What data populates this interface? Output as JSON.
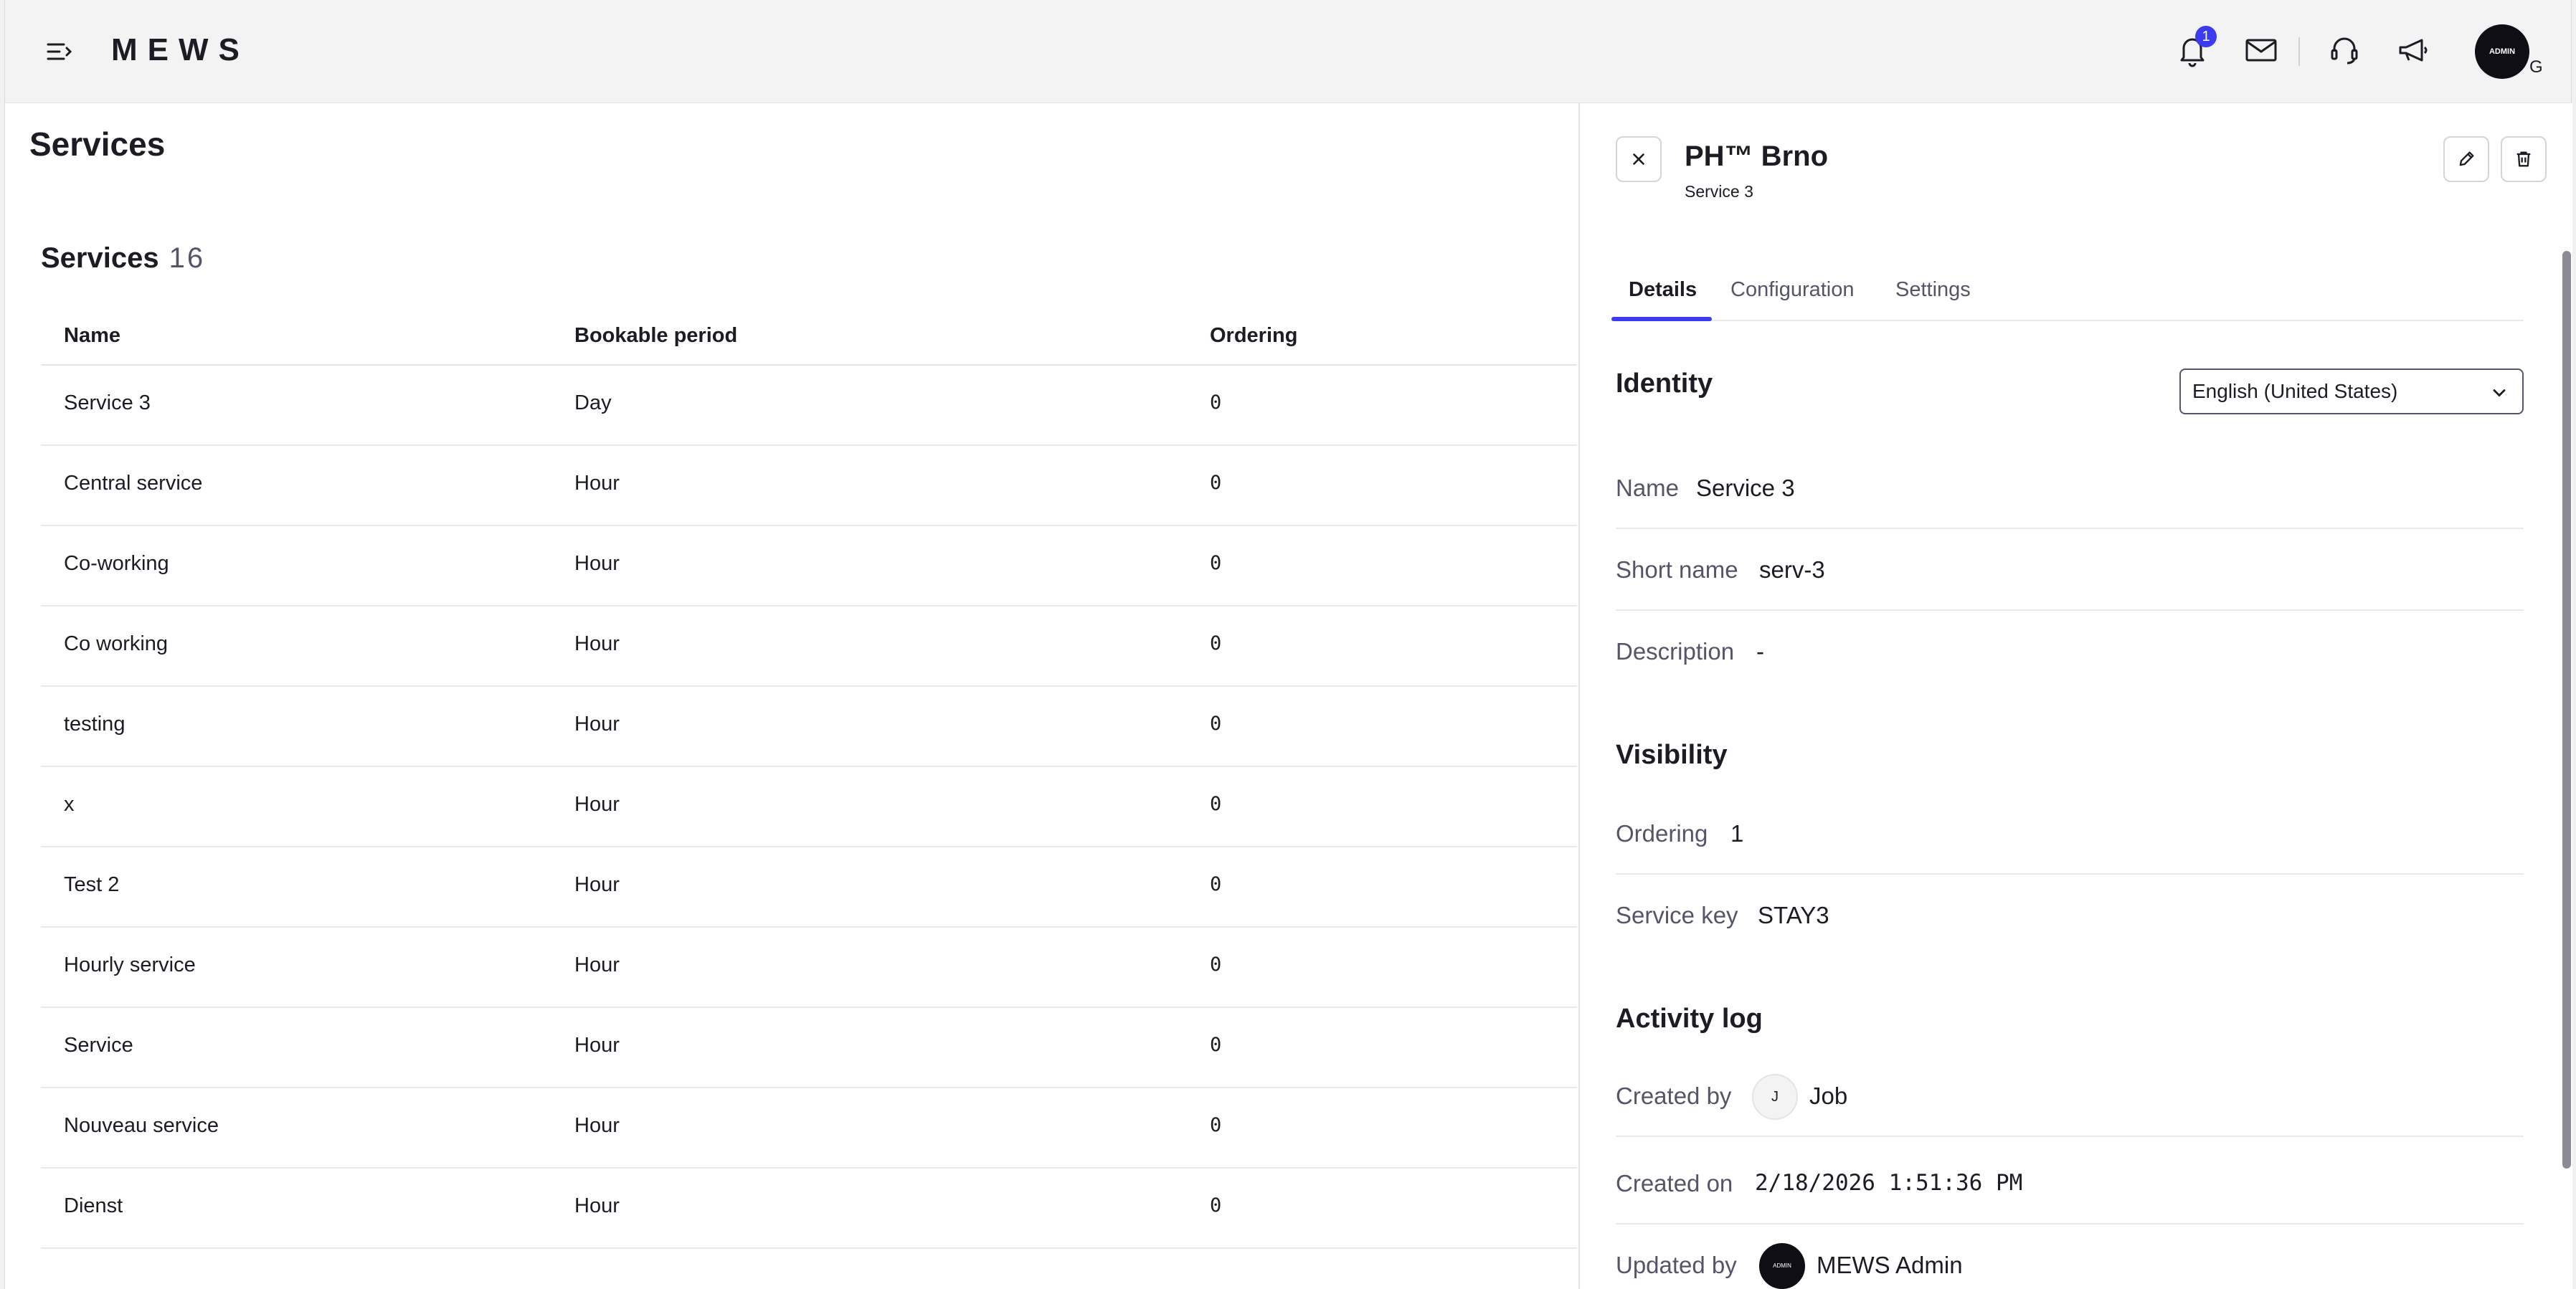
{
  "header": {
    "logo": "MEWS",
    "notification_count": "1",
    "avatar_label": "ADMIN",
    "avatar_suffix": "G"
  },
  "page": {
    "title": "Services"
  },
  "list": {
    "title": "Services",
    "count": "16",
    "columns": [
      "Name",
      "Bookable period",
      "Ordering"
    ],
    "rows": [
      {
        "name": "Service 3",
        "period": "Day",
        "ordering": "0"
      },
      {
        "name": "Central service",
        "period": "Hour",
        "ordering": "0"
      },
      {
        "name": "Co-working",
        "period": "Hour",
        "ordering": "0"
      },
      {
        "name": "Co working",
        "period": "Hour",
        "ordering": "0"
      },
      {
        "name": "testing",
        "period": "Hour",
        "ordering": "0"
      },
      {
        "name": "x",
        "period": "Hour",
        "ordering": "0"
      },
      {
        "name": "Test 2",
        "period": "Hour",
        "ordering": "0"
      },
      {
        "name": "Hourly service",
        "period": "Hour",
        "ordering": "0"
      },
      {
        "name": "Service",
        "period": "Hour",
        "ordering": "0"
      },
      {
        "name": "Nouveau service",
        "period": "Hour",
        "ordering": "0"
      },
      {
        "name": "Dienst",
        "period": "Hour",
        "ordering": "0"
      }
    ]
  },
  "panel": {
    "title": "PH™ Brno",
    "subtitle": "Service 3",
    "tabs": [
      "Details",
      "Configuration",
      "Settings"
    ],
    "identity": {
      "heading": "Identity",
      "language": "English (United States)",
      "name_label": "Name",
      "name_value": "Service 3",
      "short_label": "Short name",
      "short_value": "serv-3",
      "desc_label": "Description",
      "desc_value": "-"
    },
    "visibility": {
      "heading": "Visibility",
      "ordering_label": "Ordering",
      "ordering_value": "1",
      "key_label": "Service key",
      "key_value": "STAY3"
    },
    "activity": {
      "heading": "Activity log",
      "created_by_label": "Created by",
      "created_by_initial": "J",
      "created_by_value": "Job",
      "created_on_label": "Created on",
      "created_on_value": "2/18/2026 1:51:36 PM",
      "updated_by_label": "Updated by",
      "updated_by_avatar": "ADMIN",
      "updated_by_value": "MEWS Admin"
    }
  }
}
